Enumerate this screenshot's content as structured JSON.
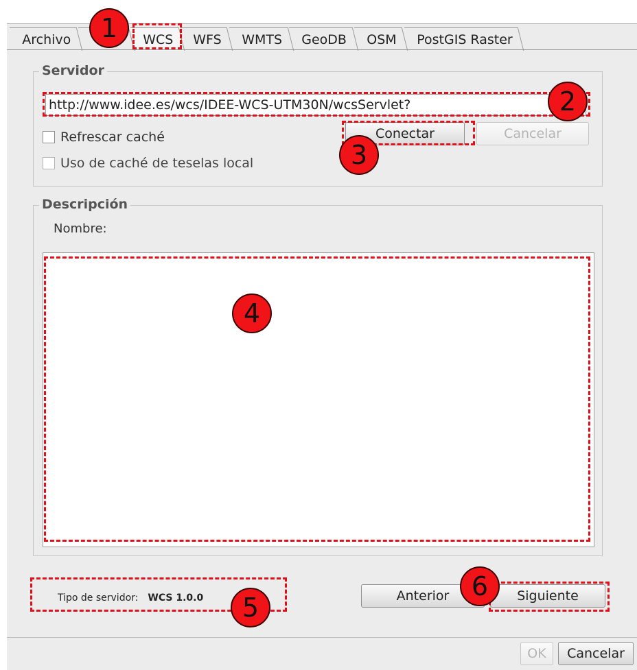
{
  "tabs": [
    "Archivo",
    "WCS",
    "WFS",
    "WMTS",
    "GeoDB",
    "OSM",
    "PostGIS Raster"
  ],
  "active_tab": "WCS",
  "server_group": {
    "title": "Servidor",
    "url_value": "http://www.idee.es/wcs/IDEE-WCS-UTM30N/wcsServlet?",
    "refresh_cache_label": "Refrescar caché",
    "tile_cache_label": "Uso de caché de teselas local",
    "connect_label": "Conectar",
    "cancel_label": "Cancelar"
  },
  "description_group": {
    "title": "Descripción",
    "name_label": "Nombre:"
  },
  "server_type": {
    "label": "Tipo de servidor:",
    "value": "WCS 1.0.0"
  },
  "wizard_nav": {
    "previous_label": "Anterior",
    "next_label": "Siguiente"
  },
  "dialog_buttons": {
    "ok_label": "OK",
    "cancel_label": "Cancelar"
  },
  "annotations": [
    "1",
    "2",
    "3",
    "4",
    "5",
    "6"
  ],
  "colors": {
    "annotation_red": "#f01419",
    "panel_bg": "#ececec"
  }
}
